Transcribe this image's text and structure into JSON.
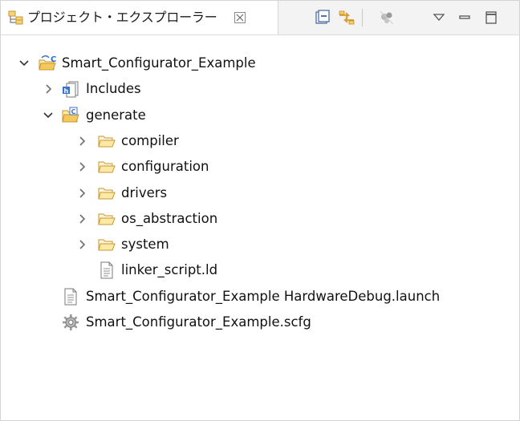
{
  "view": {
    "title": "プロジェクト・エクスプローラー",
    "toolbar": {
      "collapse_icon": "collapse-all-icon",
      "link_icon": "link-with-editor-icon",
      "filter_icon": "filter-icon",
      "menu_icon": "view-menu-icon",
      "minimize_icon": "minimize-icon",
      "maximize_icon": "maximize-icon"
    }
  },
  "tree": {
    "project": "Smart_Configurator_Example",
    "includes": "Includes",
    "generate": "generate",
    "generate_children": [
      "compiler",
      "configuration",
      "drivers",
      "os_abstraction",
      "system"
    ],
    "linker": "linker_script.ld",
    "launch": "Smart_Configurator_Example HardwareDebug.launch",
    "scfg": "Smart_Configurator_Example.scfg"
  },
  "colors": {
    "folder": "#e0b04a",
    "folder_fill": "#fde9a6",
    "blue": "#3b73c9",
    "chevron": "#6e6e6e"
  }
}
